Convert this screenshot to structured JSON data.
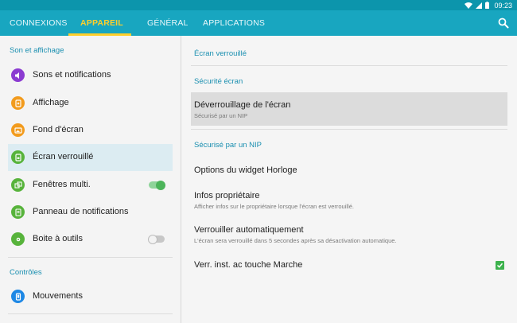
{
  "status_bar": {
    "time": "09:23"
  },
  "tabs": [
    {
      "label": "CONNEXIONS"
    },
    {
      "label": "APPAREIL"
    },
    {
      "label": "GÉNÉRAL"
    },
    {
      "label": "APPLICATIONS"
    }
  ],
  "sidebar": {
    "sections": [
      {
        "title": "Son et affichage"
      },
      {
        "title": "Contrôles"
      }
    ],
    "items": [
      {
        "label": "Sons et notifications",
        "icon": "volume-icon",
        "color": "#8b3bd1"
      },
      {
        "label": "Affichage",
        "icon": "display-icon",
        "color": "#f29b1d"
      },
      {
        "label": "Fond d'écran",
        "icon": "wallpaper-icon",
        "color": "#f29b1d"
      },
      {
        "label": "Écran verrouillé",
        "icon": "lock-screen-icon",
        "color": "#57b33b",
        "selected": true
      },
      {
        "label": "Fenêtres multi.",
        "icon": "multi-window-icon",
        "color": "#57b33b",
        "toggle": true
      },
      {
        "label": "Panneau de notifications",
        "icon": "notification-panel-icon",
        "color": "#57b33b"
      },
      {
        "label": "Boite à outils",
        "icon": "toolbox-icon",
        "color": "#57b33b",
        "toggle": false
      },
      {
        "label": "Mouvements",
        "icon": "motion-icon",
        "color": "#1e88e5"
      }
    ]
  },
  "main": {
    "heading": "Écran verrouillé",
    "sections": [
      {
        "title": "Sécurité écran"
      },
      {
        "title": "Sécurisé par un NIP"
      }
    ],
    "items": [
      {
        "title": "Déverrouillage de l'écran",
        "subtitle": "Sécurisé par un NIP",
        "highlighted": true
      },
      {
        "title": "Options du widget Horloge"
      },
      {
        "title": "Infos propriétaire",
        "subtitle": "Afficher infos sur le propriétaire lorsque l'écran est verrouillé."
      },
      {
        "title": "Verrouiller automatiquement",
        "subtitle": "L'écran sera verrouillé dans 5 secondes après sa désactivation automatique."
      },
      {
        "title": "Verr. inst. ac touche Marche",
        "checked": true
      }
    ]
  },
  "colors": {
    "status_bar": "#0c95ac",
    "tab_bar": "#18a6c0",
    "tab_active": "#ffcf2c",
    "accent_text": "#1a8fb0",
    "toggle_on": "#4cb45a"
  }
}
